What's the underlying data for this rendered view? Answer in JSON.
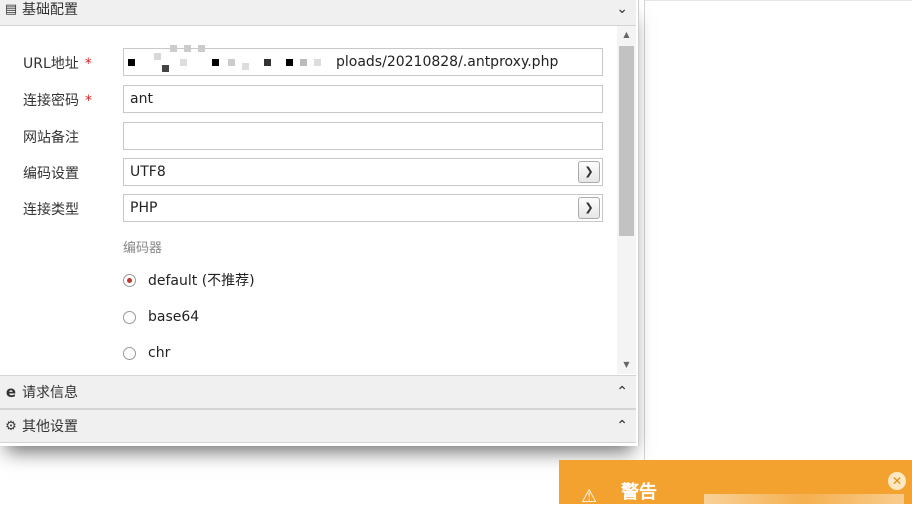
{
  "sections": {
    "basic": {
      "title": "基础配置",
      "chevron": "chevron-down"
    },
    "request": {
      "title": "请求信息",
      "chevron": "chevron-up"
    },
    "other": {
      "title": "其他设置",
      "chevron": "chevron-up"
    }
  },
  "form": {
    "url": {
      "label": "URL地址",
      "required": "*",
      "value": "ploads/20210828/.antproxy.php"
    },
    "password": {
      "label": "连接密码",
      "required": "*",
      "value": "ant"
    },
    "note": {
      "label": "网站备注",
      "value": ""
    },
    "encoding": {
      "label": "编码设置",
      "value": "UTF8"
    },
    "type": {
      "label": "连接类型",
      "value": "PHP"
    },
    "encoder": {
      "label": "编码器",
      "options": [
        {
          "label": "default (不推荐)",
          "checked": true
        },
        {
          "label": "base64",
          "checked": false
        },
        {
          "label": "chr",
          "checked": false
        }
      ]
    }
  },
  "toast": {
    "title": "警告",
    "icon": "warning-icon",
    "color": "#f3a230"
  },
  "colors": {
    "required": "#e02020",
    "radio_checked": "#c0392b"
  }
}
